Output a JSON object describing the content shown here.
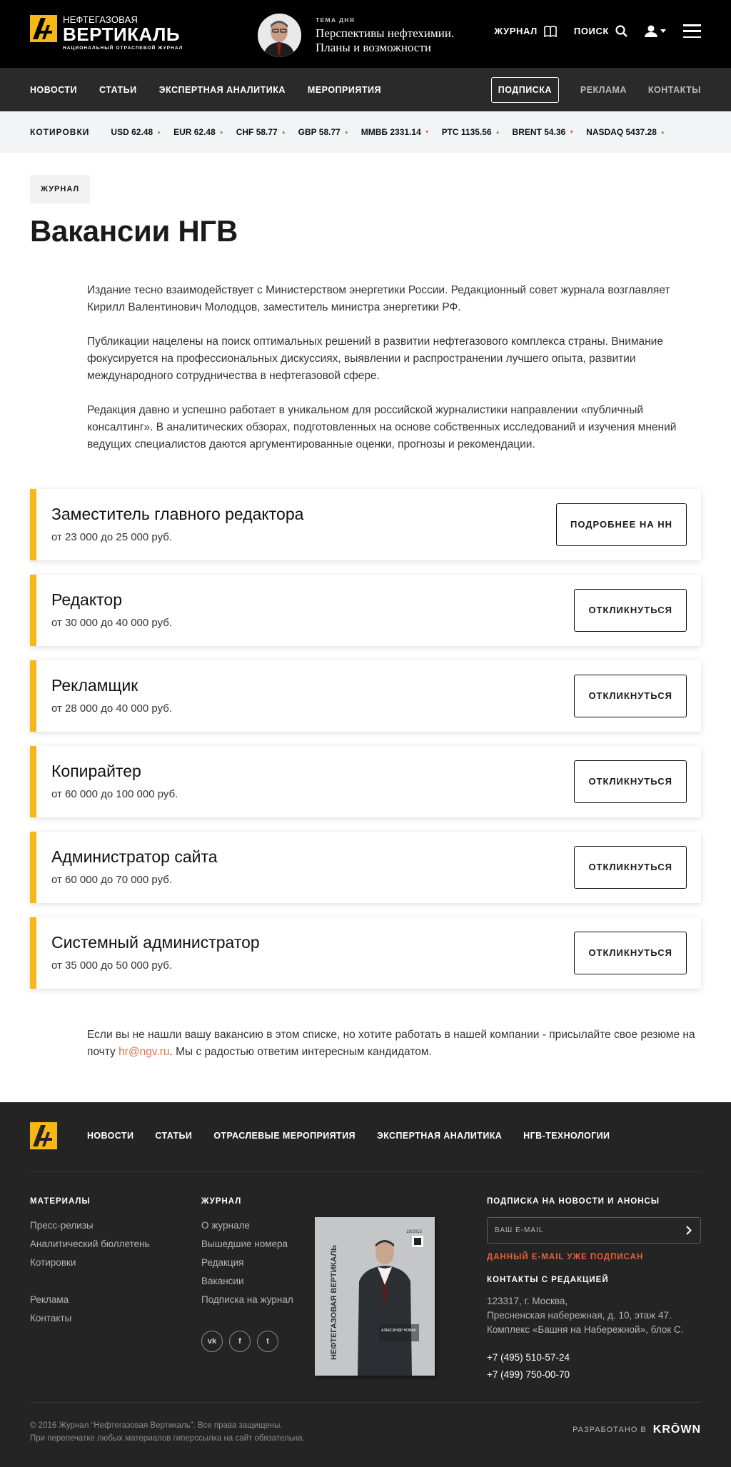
{
  "header": {
    "logo": {
      "top": "НЕФТЕГАЗОВАЯ",
      "main": "ВЕРТИКАЛЬ",
      "sub": "НАЦИОНАЛЬНЫЙ ОТРАСЛЕВОЙ ЖУРНАЛ"
    },
    "topic": {
      "label": "ТЕМА ДНЯ",
      "title": "Перспективы нефтехимии. Планы и возможности"
    },
    "journal_label": "ЖУРНАЛ",
    "search_label": "ПОИСК"
  },
  "nav": {
    "items": [
      "НОВОСТИ",
      "СТАТЬИ",
      "ЭКСПЕРТНАЯ АНАЛИТИКА",
      "МЕРОПРИЯТИЯ"
    ],
    "subscribe": "ПОДПИСКА",
    "ads": "РЕКЛАМА",
    "contacts": "КОНТАКТЫ"
  },
  "quotes": {
    "label": "КОТИРОВКИ",
    "items": [
      {
        "text": "USD 62.48",
        "trend": "up"
      },
      {
        "text": "EUR 62.48",
        "trend": "up"
      },
      {
        "text": "CHF 58.77",
        "trend": "up"
      },
      {
        "text": "GBP 58.77",
        "trend": "up"
      },
      {
        "text": "ММВБ 2331.14",
        "trend": "down"
      },
      {
        "text": "РТС 1135.56",
        "trend": "up"
      },
      {
        "text": "BRENT 54.36",
        "trend": "down"
      },
      {
        "text": "NASDAQ 5437.28",
        "trend": "up"
      }
    ]
  },
  "main": {
    "tag": "ЖУРНАЛ",
    "title": "Вакансии НГВ",
    "paragraphs": [
      "Издание тесно взаимодействует с Министерством энергетики России. Редакционный совет журнала возглавляет Кирилл Валентинович Молодцов, заместитель министра энергетики РФ.",
      "Публикации нацелены на поиск оптимальных решений в развитии нефтегазового комплекса страны. Внимание фокусируется на профессиональных дискуссиях, выявлении и распространении лучшего опыта, развитии международного сотрудничества в нефтегазовой сфере.",
      "Редакция давно и успешно работает в уникальном для российской журналистики направлении «публичный консалтинг». В аналитических обзорах, подготовленных на основе собственных исследований и изучения мнений ведущих специалистов даются аргументированные оценки, прогнозы и рекомендации."
    ],
    "vacancies": [
      {
        "title": "Заместитель главного редактора",
        "salary": "от 23 000 до 25 000 руб.",
        "button": "ПОДРОБНЕЕ НА НН"
      },
      {
        "title": "Редактор",
        "salary": "от 30 000 до 40 000 руб.",
        "button": "ОТКЛИКНУТЬСЯ"
      },
      {
        "title": "Рекламщик",
        "salary": "от 28 000 до 40 000 руб.",
        "button": "ОТКЛИКНУТЬСЯ"
      },
      {
        "title": "Копирайтер",
        "salary": "от 60 000 до 100 000 руб.",
        "button": "ОТКЛИКНУТЬСЯ"
      },
      {
        "title": "Администратор сайта",
        "salary": "от 60 000 до 70 000 руб.",
        "button": "ОТКЛИКНУТЬСЯ"
      },
      {
        "title": "Системный администратор",
        "salary": "от 35 000 до 50 000 руб.",
        "button": "ОТКЛИКНУТЬСЯ"
      }
    ],
    "outro_before": "Если вы не нашли вашу вакансию в этом списке, но хотите работать в нашей компании - присылайте свое резюме на почту ",
    "outro_email": "hr@ngv.ru",
    "outro_after": ". Мы с радостью ответим интересным кандидатом."
  },
  "footer": {
    "nav": [
      "НОВОСТИ",
      "СТАТЬИ",
      "ОТРАСЛЕВЫЕ МЕРОПРИЯТИЯ",
      "ЭКСПЕРТНАЯ АНАЛИТИКА",
      "НГВ-ТЕХНОЛОГИИ"
    ],
    "materials": {
      "title": "МАТЕРИАЛЫ",
      "links": [
        "Пресс-релизы",
        "Аналитический бюллетень",
        "Котировки"
      ],
      "links2": [
        "Реклама",
        "Контакты"
      ]
    },
    "journal": {
      "title": "ЖУРНАЛ",
      "links": [
        "О журнале",
        "Вышедшие номера",
        "Редакция",
        "Вакансии",
        "Подписка на журнал"
      ]
    },
    "cover": {
      "issue": "19/2015",
      "vertical_text": "НЕФТЕГАЗОВАЯ ВЕРТИКАЛЬ",
      "caption": "АЛЕКСАНДР НОВАК:"
    },
    "social": [
      "vk",
      "f",
      "t"
    ],
    "subscribe": {
      "title": "ПОДПИСКА НА НОВОСТИ И АНОНСЫ",
      "placeholder": "ВАШ E-MAIL",
      "error": "ДАННЫЙ E-MAIL УЖЕ ПОДПИСАН"
    },
    "contacts": {
      "title": "КОНТАКТЫ С РЕДАКЦИЕЙ",
      "address": [
        "123317, г. Москва,",
        "Пресненская набережная, д. 10, этаж 47.",
        "Комплекс «Башня на Набережной», блок С."
      ],
      "phones": [
        "+7 (495) 510-57-24",
        "+7 (499) 750-00-70"
      ]
    },
    "copyright": [
      "© 2016 Журнал “Нефтегазовая Вертикаль”. Все права защищены.",
      "При перепечатке любых материалов гиперссылка на сайт обязательна."
    ],
    "developed_label": "РАЗРАБОТАНО В",
    "developer": "KRŌWN"
  },
  "colors": {
    "accent": "#f7b718",
    "error": "#e8633a",
    "up": "#3bb54a",
    "down": "#e85a2a",
    "link": "#e0704a"
  }
}
